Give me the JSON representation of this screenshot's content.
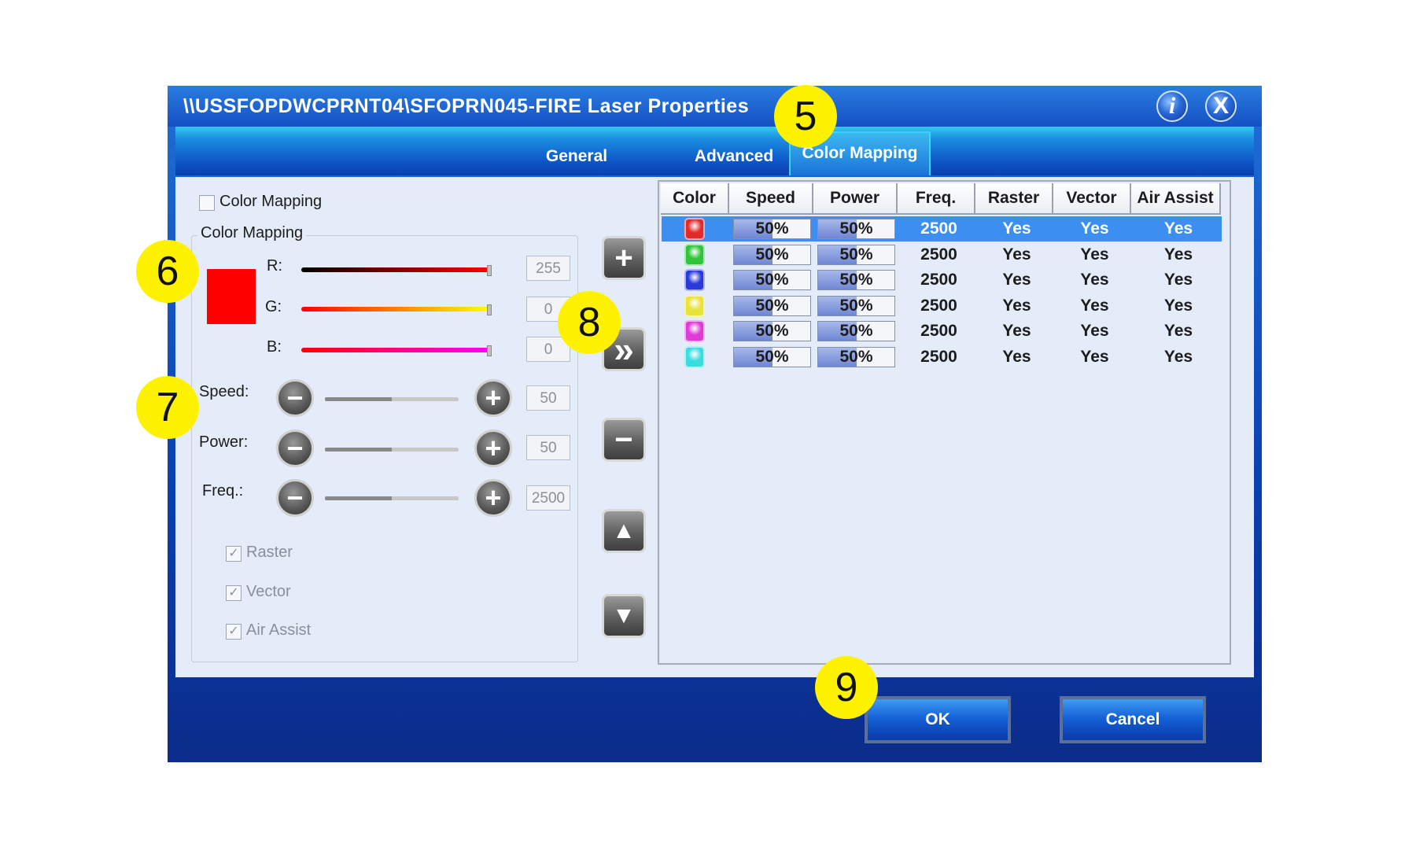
{
  "window": {
    "title": "\\\\USSFOPDWCPRNT04\\SFOPRN045-FIRE Laser Properties",
    "info_label": "i",
    "close_label": "X"
  },
  "tabs": [
    {
      "label": "General"
    },
    {
      "label": "Advanced"
    },
    {
      "label": "Color Mapping",
      "active": true
    }
  ],
  "left_panel": {
    "enable_label": "Color Mapping",
    "enable_checked": false,
    "group_label": "Color Mapping",
    "swatch_color": "#ff0000",
    "r_label": "R:",
    "r_value": "255",
    "g_label": "G:",
    "g_value": "0",
    "b_label": "B:",
    "b_value": "0",
    "speed_label": "Speed:",
    "speed_value": "50",
    "power_label": "Power:",
    "power_value": "50",
    "freq_label": "Freq.:",
    "freq_value": "2500",
    "minus_icon": "−",
    "plus_icon": "+",
    "raster_label": "Raster",
    "vector_label": "Vector",
    "air_label": "Air Assist",
    "check_mark": "✓"
  },
  "actions": {
    "add": "+",
    "apply": "»",
    "remove": "−",
    "up": "▲",
    "down": "▼"
  },
  "table": {
    "headers": [
      "Color",
      "Speed",
      "Power",
      "Freq.",
      "Raster",
      "Vector",
      "Air Assist"
    ],
    "rows": [
      {
        "color": "#e32a2a",
        "speed": "50%",
        "power": "50%",
        "freq": "2500",
        "raster": "Yes",
        "vector": "Yes",
        "air": "Yes",
        "selected": true
      },
      {
        "color": "#2fc43a",
        "speed": "50%",
        "power": "50%",
        "freq": "2500",
        "raster": "Yes",
        "vector": "Yes",
        "air": "Yes"
      },
      {
        "color": "#2a3ad8",
        "speed": "50%",
        "power": "50%",
        "freq": "2500",
        "raster": "Yes",
        "vector": "Yes",
        "air": "Yes"
      },
      {
        "color": "#e8e23a",
        "speed": "50%",
        "power": "50%",
        "freq": "2500",
        "raster": "Yes",
        "vector": "Yes",
        "air": "Yes"
      },
      {
        "color": "#e03ad6",
        "speed": "50%",
        "power": "50%",
        "freq": "2500",
        "raster": "Yes",
        "vector": "Yes",
        "air": "Yes"
      },
      {
        "color": "#3adce0",
        "speed": "50%",
        "power": "50%",
        "freq": "2500",
        "raster": "Yes",
        "vector": "Yes",
        "air": "Yes"
      }
    ],
    "bar_fraction": 0.5
  },
  "buttons": {
    "ok": "OK",
    "cancel": "Cancel"
  },
  "callouts": [
    "5",
    "6",
    "7",
    "8",
    "9"
  ]
}
